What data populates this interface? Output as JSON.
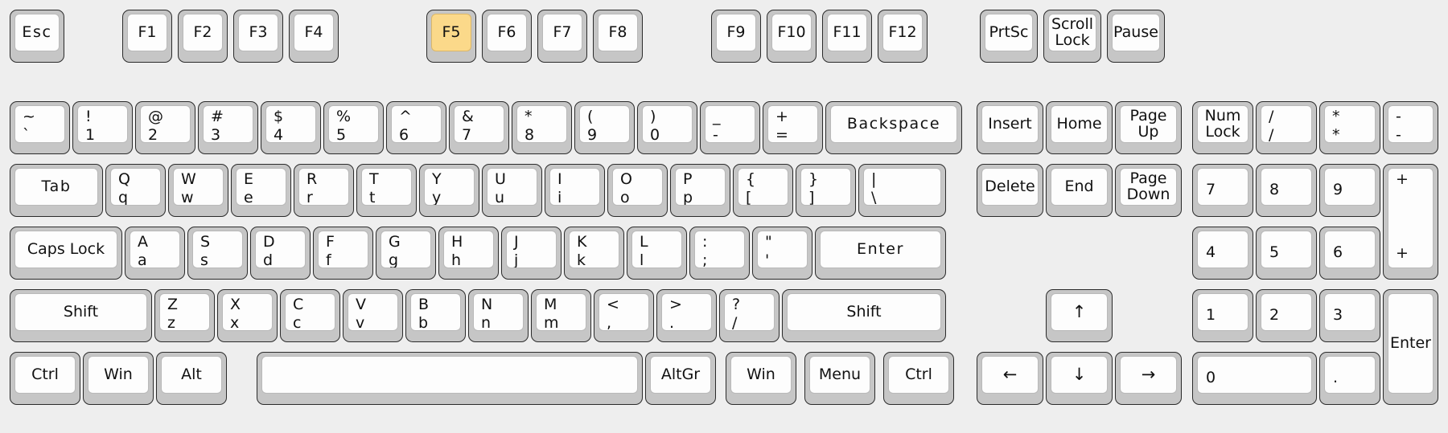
{
  "meta": {
    "title": "On-screen keyboard layout",
    "highlight_color": "#fbd98a",
    "key_body_color": "#c6c6c6",
    "keycap_color": "#fdfdfd",
    "background_color": "#eeeeee",
    "highlighted_key": "F5"
  },
  "function_row": {
    "esc": "Esc",
    "f1": "F1",
    "f2": "F2",
    "f3": "F3",
    "f4": "F4",
    "f5": "F5",
    "f6": "F6",
    "f7": "F7",
    "f8": "F8",
    "f9": "F9",
    "f10": "F10",
    "f11": "F11",
    "f12": "F12",
    "prtsc": "PrtSc",
    "scroll_lock_1": "Scroll",
    "scroll_lock_2": "Lock",
    "pause": "Pause"
  },
  "number_row": {
    "tilde_up": "~",
    "tilde_lo": "`",
    "k1_up": "!",
    "k1_lo": "1",
    "k2_up": "@",
    "k2_lo": "2",
    "k3_up": "#",
    "k3_lo": "3",
    "k4_up": "$",
    "k4_lo": "4",
    "k5_up": "%",
    "k5_lo": "5",
    "k6_up": "^",
    "k6_lo": "6",
    "k7_up": "&",
    "k7_lo": "7",
    "k8_up": "*",
    "k8_lo": "8",
    "k9_up": "(",
    "k9_lo": "9",
    "k0_up": ")",
    "k0_lo": "0",
    "minus_up": "_",
    "minus_lo": "-",
    "equal_up": "+",
    "equal_lo": "=",
    "backspace": "Backspace"
  },
  "tab_row": {
    "tab": "Tab",
    "q_up": "Q",
    "q_lo": "q",
    "w_up": "W",
    "w_lo": "w",
    "e_up": "E",
    "e_lo": "e",
    "r_up": "R",
    "r_lo": "r",
    "t_up": "T",
    "t_lo": "t",
    "y_up": "Y",
    "y_lo": "y",
    "u_up": "U",
    "u_lo": "u",
    "i_up": "I",
    "i_lo": "i",
    "o_up": "O",
    "o_lo": "o",
    "p_up": "P",
    "p_lo": "p",
    "lbr_up": "{",
    "lbr_lo": "[",
    "rbr_up": "}",
    "rbr_lo": "]",
    "bsl_up": "|",
    "bsl_lo": "\\"
  },
  "home_row": {
    "caps_lock": "Caps Lock",
    "a_up": "A",
    "a_lo": "a",
    "s_up": "S",
    "s_lo": "s",
    "d_up": "D",
    "d_lo": "d",
    "f_up": "F",
    "f_lo": "f",
    "g_up": "G",
    "g_lo": "g",
    "h_up": "H",
    "h_lo": "h",
    "j_up": "J",
    "j_lo": "j",
    "k_up": "K",
    "k_lo": "k",
    "l_up": "L",
    "l_lo": "l",
    "semi_up": ":",
    "semi_lo": ";",
    "quote_up": "\"",
    "quote_lo": "'",
    "enter": "Enter"
  },
  "shift_row": {
    "shift_left": "Shift",
    "z_up": "Z",
    "z_lo": "z",
    "x_up": "X",
    "x_lo": "x",
    "c_up": "C",
    "c_lo": "c",
    "v_up": "V",
    "v_lo": "v",
    "b_up": "B",
    "b_lo": "b",
    "n_up": "N",
    "n_lo": "n",
    "m_up": "M",
    "m_lo": "m",
    "comma_up": "<",
    "comma_lo": ",",
    "period_up": ">",
    "period_lo": ".",
    "slash_up": "?",
    "slash_lo": "/",
    "shift_right": "Shift"
  },
  "bottom_row": {
    "ctrl_left": "Ctrl",
    "win_left": "Win",
    "alt": "Alt",
    "space": "",
    "altgr": "AltGr",
    "win_right": "Win",
    "menu": "Menu",
    "ctrl_right": "Ctrl"
  },
  "nav_cluster": {
    "insert": "Insert",
    "home": "Home",
    "page_up_1": "Page",
    "page_up_2": "Up",
    "delete": "Delete",
    "end": "End",
    "page_down_1": "Page",
    "page_down_2": "Down",
    "arrow_up": "↑",
    "arrow_left": "←",
    "arrow_down": "↓",
    "arrow_right": "→"
  },
  "numpad": {
    "num_lock_1": "Num",
    "num_lock_2": "Lock",
    "divide_up": "/",
    "divide_lo": "/",
    "multiply_up": "*",
    "multiply_lo": "*",
    "subtract_up": "-",
    "subtract_lo": "-",
    "n7": "7",
    "n8": "8",
    "n9": "9",
    "add_up": "+",
    "add_lo": "+",
    "n4": "4",
    "n5": "5",
    "n6": "6",
    "n1": "1",
    "n2": "2",
    "n3": "3",
    "enter": "Enter",
    "n0": "0",
    "decimal": "."
  }
}
